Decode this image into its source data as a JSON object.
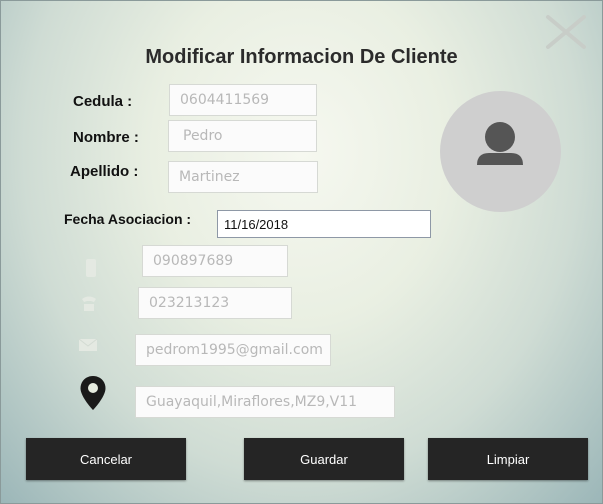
{
  "form": {
    "title": "Modificar Informacion De Cliente",
    "labels": {
      "cedula": "Cedula :",
      "nombre": "Nombre :",
      "apellido": "Apellido :",
      "fecha": "Fecha Asociacion :"
    },
    "values": {
      "cedula": "0604411569",
      "nombre": "Pedro",
      "apellido": "Martinez",
      "fecha": "11/16/2018",
      "celular": "090897689",
      "telefono": "023213123",
      "email": "pedrom1995@gmail.com",
      "direccion": "Guayaquil,Miraflores,MZ9,V11"
    },
    "icons": {
      "close": "close-icon",
      "avatar": "user-icon",
      "phone_mobile": "mobile-phone-icon",
      "phone": "phone-icon",
      "email": "envelope-icon",
      "address": "map-pin-icon"
    }
  },
  "buttons": {
    "cancel": "Cancelar",
    "save": "Guardar",
    "clear": "Limpiar"
  },
  "colors": {
    "button_bg": "#252525",
    "avatar_bg": "#cfcfcf",
    "avatar_fg": "#555555"
  }
}
